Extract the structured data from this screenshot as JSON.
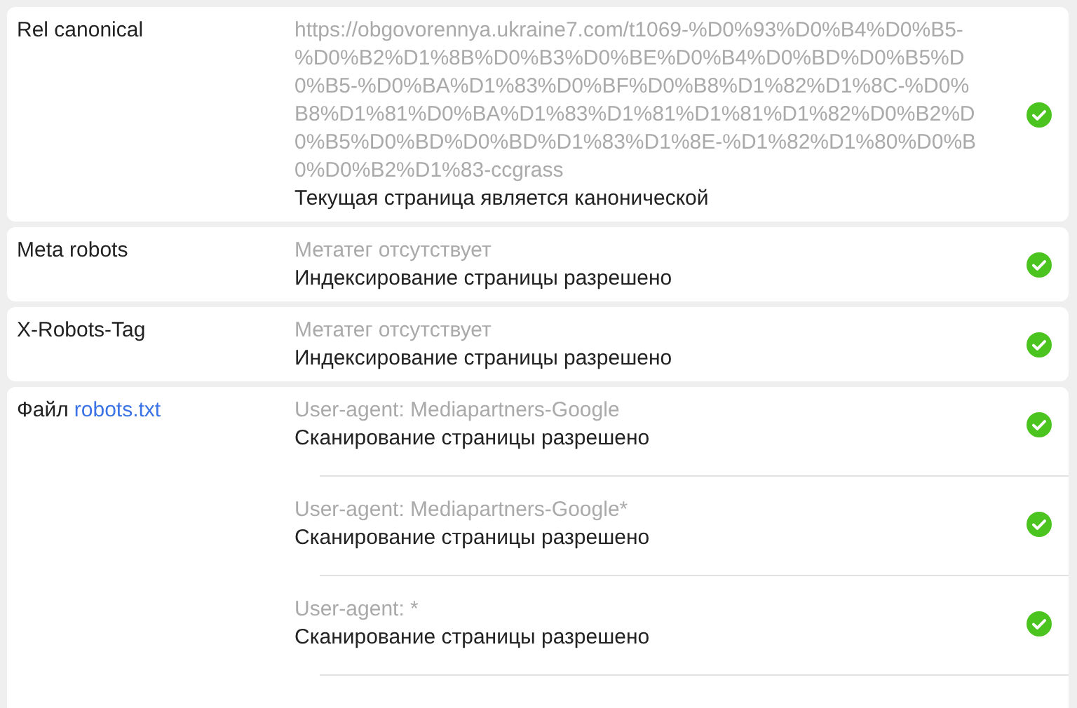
{
  "sections": [
    {
      "label": "Rel canonical",
      "entries": [
        {
          "detail": "https://obgovorennya.ukraine7.com/t1069-%D0%93%D0%B4%D0%B5-%D0%B2%D1%8B%D0%B3%D0%BE%D0%B4%D0%BD%D0%B5%D0%B5-%D0%BA%D1%83%D0%BF%D0%B8%D1%82%D1%8C-%D0%B8%D1%81%D0%BA%D1%83%D1%81%D1%81%D1%82%D0%B2%D0%B5%D0%BD%D0%BD%D1%83%D1%8E-%D1%82%D1%80%D0%B0%D0%B2%D1%83-ccgrass",
          "result": "Текущая страница является канонической",
          "passed": true
        }
      ]
    },
    {
      "label": "Meta robots",
      "entries": [
        {
          "detail": "Метатег отсутствует",
          "result": "Индексирование страницы разрешено",
          "passed": true
        }
      ]
    },
    {
      "label": "X-Robots-Tag",
      "entries": [
        {
          "detail": "Метатег отсутствует",
          "result": "Индексирование страницы разрешено",
          "passed": true
        }
      ]
    },
    {
      "label": "Файл",
      "link": "robots.txt",
      "entries": [
        {
          "detail": "User-agent: Mediapartners-Google",
          "result": "Сканирование страницы разрешено",
          "passed": true
        },
        {
          "detail": "User-agent: Mediapartners-Google*",
          "result": "Сканирование страницы разрешено",
          "passed": true
        },
        {
          "detail": "User-agent: *",
          "result": "Сканирование страницы разрешено",
          "passed": true
        }
      ]
    }
  ]
}
